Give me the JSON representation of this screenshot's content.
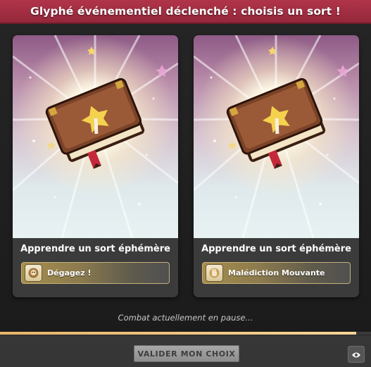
{
  "header": {
    "title": "Glyphé événementiel déclenché : choisis un sort !"
  },
  "cards": [
    {
      "title": "Apprendre un sort éphémère",
      "spell_name": "Dégagez !",
      "spell_icon": "dragon-head-icon",
      "art_icon": "spell-book-icon"
    },
    {
      "title": "Apprendre un sort éphémère",
      "spell_name": "Malédiction Mouvante",
      "spell_icon": "hand-curse-icon",
      "art_icon": "spell-book-icon"
    }
  ],
  "status": {
    "pause_text": "Combat actuellement en pause...",
    "progress": 0.96
  },
  "footer": {
    "validate_label": "VALIDER MON CHOIX",
    "eye_icon": "eye-icon"
  },
  "colors": {
    "title_bar": "#a32e42",
    "progress_fill": "#f0c882",
    "spell_button_gold": "#a78e4c",
    "validate_button": "#9b9b9b"
  }
}
